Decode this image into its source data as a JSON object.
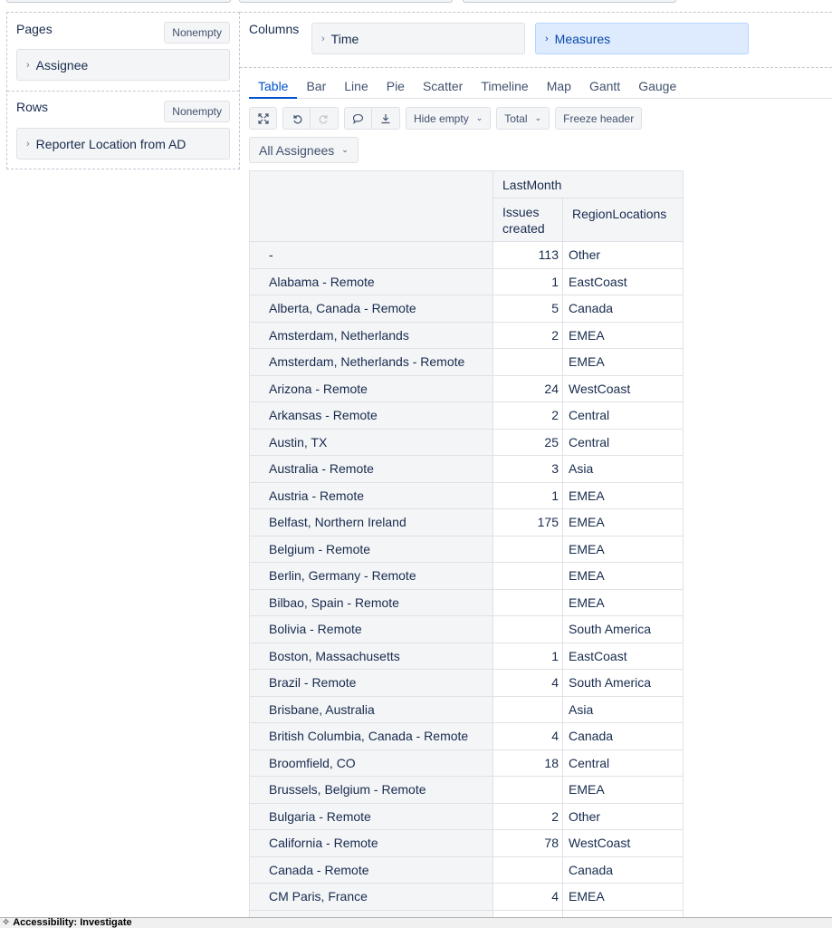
{
  "pages": {
    "title": "Pages",
    "nonempty_label": "Nonempty",
    "dimension": "Assignee"
  },
  "rows": {
    "title": "Rows",
    "nonempty_label": "Nonempty",
    "dimension": "Reporter Location from AD"
  },
  "columns": {
    "title": "Columns",
    "items": [
      "Time",
      "Measures"
    ]
  },
  "tabs": [
    "Table",
    "Bar",
    "Line",
    "Pie",
    "Scatter",
    "Timeline",
    "Map",
    "Gantt",
    "Gauge"
  ],
  "active_tab": "Table",
  "toolbar": {
    "icons": [
      "expand-icon",
      "undo-icon",
      "redo-icon",
      "comment-icon",
      "download-icon"
    ],
    "hide_empty_label": "Hide empty",
    "total_label": "Total",
    "freeze_header_label": "Freeze header"
  },
  "filter": {
    "assignees_label": "All Assignees"
  },
  "table": {
    "period_header": "LastMonth",
    "measure_headers": [
      "Issues created",
      "RegionLocations"
    ],
    "rows": [
      {
        "location": "-",
        "issues": "113",
        "region": "Other"
      },
      {
        "location": "Alabama - Remote",
        "issues": "1",
        "region": "EastCoast"
      },
      {
        "location": "Alberta, Canada - Remote",
        "issues": "5",
        "region": "Canada"
      },
      {
        "location": "Amsterdam, Netherlands",
        "issues": "2",
        "region": "EMEA"
      },
      {
        "location": "Amsterdam, Netherlands - Remote",
        "issues": "",
        "region": "EMEA"
      },
      {
        "location": "Arizona - Remote",
        "issues": "24",
        "region": "WestCoast"
      },
      {
        "location": "Arkansas - Remote",
        "issues": "2",
        "region": "Central"
      },
      {
        "location": "Austin, TX",
        "issues": "25",
        "region": "Central"
      },
      {
        "location": "Australia - Remote",
        "issues": "3",
        "region": "Asia"
      },
      {
        "location": "Austria - Remote",
        "issues": "1",
        "region": "EMEA"
      },
      {
        "location": "Belfast, Northern Ireland",
        "issues": "175",
        "region": "EMEA"
      },
      {
        "location": "Belgium - Remote",
        "issues": "",
        "region": "EMEA"
      },
      {
        "location": "Berlin, Germany - Remote",
        "issues": "",
        "region": "EMEA"
      },
      {
        "location": "Bilbao, Spain - Remote",
        "issues": "",
        "region": "EMEA"
      },
      {
        "location": "Bolivia - Remote",
        "issues": "",
        "region": "South America"
      },
      {
        "location": "Boston, Massachusetts",
        "issues": "1",
        "region": "EastCoast"
      },
      {
        "location": "Brazil - Remote",
        "issues": "4",
        "region": "South America"
      },
      {
        "location": "Brisbane, Australia",
        "issues": "",
        "region": "Asia"
      },
      {
        "location": "British Columbia, Canada - Remote",
        "issues": "4",
        "region": "Canada"
      },
      {
        "location": "Broomfield, CO",
        "issues": "18",
        "region": "Central"
      },
      {
        "location": "Brussels, Belgium - Remote",
        "issues": "",
        "region": "EMEA"
      },
      {
        "location": "Bulgaria - Remote",
        "issues": "2",
        "region": "Other"
      },
      {
        "location": "California - Remote",
        "issues": "78",
        "region": "WestCoast"
      },
      {
        "location": "Canada - Remote",
        "issues": "",
        "region": "Canada"
      },
      {
        "location": "CM Paris, France",
        "issues": "4",
        "region": "EMEA"
      },
      {
        "location": "",
        "issues": "",
        "region": ""
      }
    ]
  },
  "statusbar": {
    "text": "Accessibility: Investigate"
  }
}
